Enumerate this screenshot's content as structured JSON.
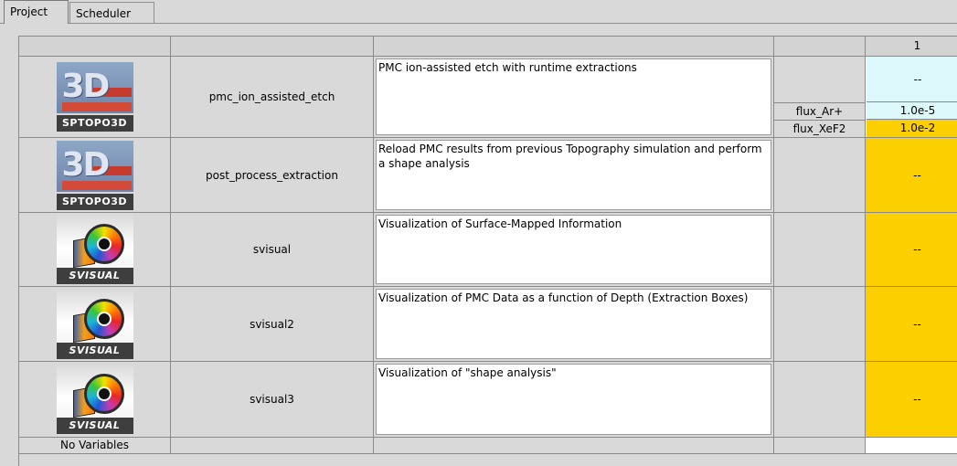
{
  "tabs": [
    {
      "label": "Project",
      "active": true
    },
    {
      "label": "Scheduler",
      "active": false
    }
  ],
  "header": {
    "experiment_number": "1"
  },
  "rows": [
    {
      "icon": "sptopo3d-icon",
      "icon_label": "SPTOPO3D",
      "name": "pmc_ion_assisted_etch",
      "description": "PMC ion-assisted etch with runtime extractions",
      "params": [
        {
          "name": "",
          "value": "--"
        },
        {
          "name": "flux_Ar+",
          "value": "1.0e-5"
        },
        {
          "name": "flux_XeF2",
          "value": "1.0e-2"
        }
      ]
    },
    {
      "icon": "sptopo3d-icon",
      "icon_label": "SPTOPO3D",
      "name": "post_process_extraction",
      "description": "Reload PMC results from previous Topography simulation and perform a shape analysis",
      "value": "--"
    },
    {
      "icon": "svisual-icon",
      "icon_label": "SVISUAL",
      "name": "svisual",
      "description": "Visualization of Surface-Mapped Information",
      "value": "--"
    },
    {
      "icon": "svisual-icon",
      "icon_label": "SVISUAL",
      "name": "svisual2",
      "description": "Visualization of PMC Data as a function of Depth (Extraction Boxes)",
      "value": "--"
    },
    {
      "icon": "svisual-icon",
      "icon_label": "SVISUAL",
      "name": "svisual3",
      "description": "Visualization of \"shape analysis\"",
      "value": "--"
    }
  ],
  "footer": {
    "label": "No Variables"
  },
  "colors": {
    "pending": "#fcd000",
    "selected": "#dcf8fa",
    "background": "#d9d9d9"
  }
}
